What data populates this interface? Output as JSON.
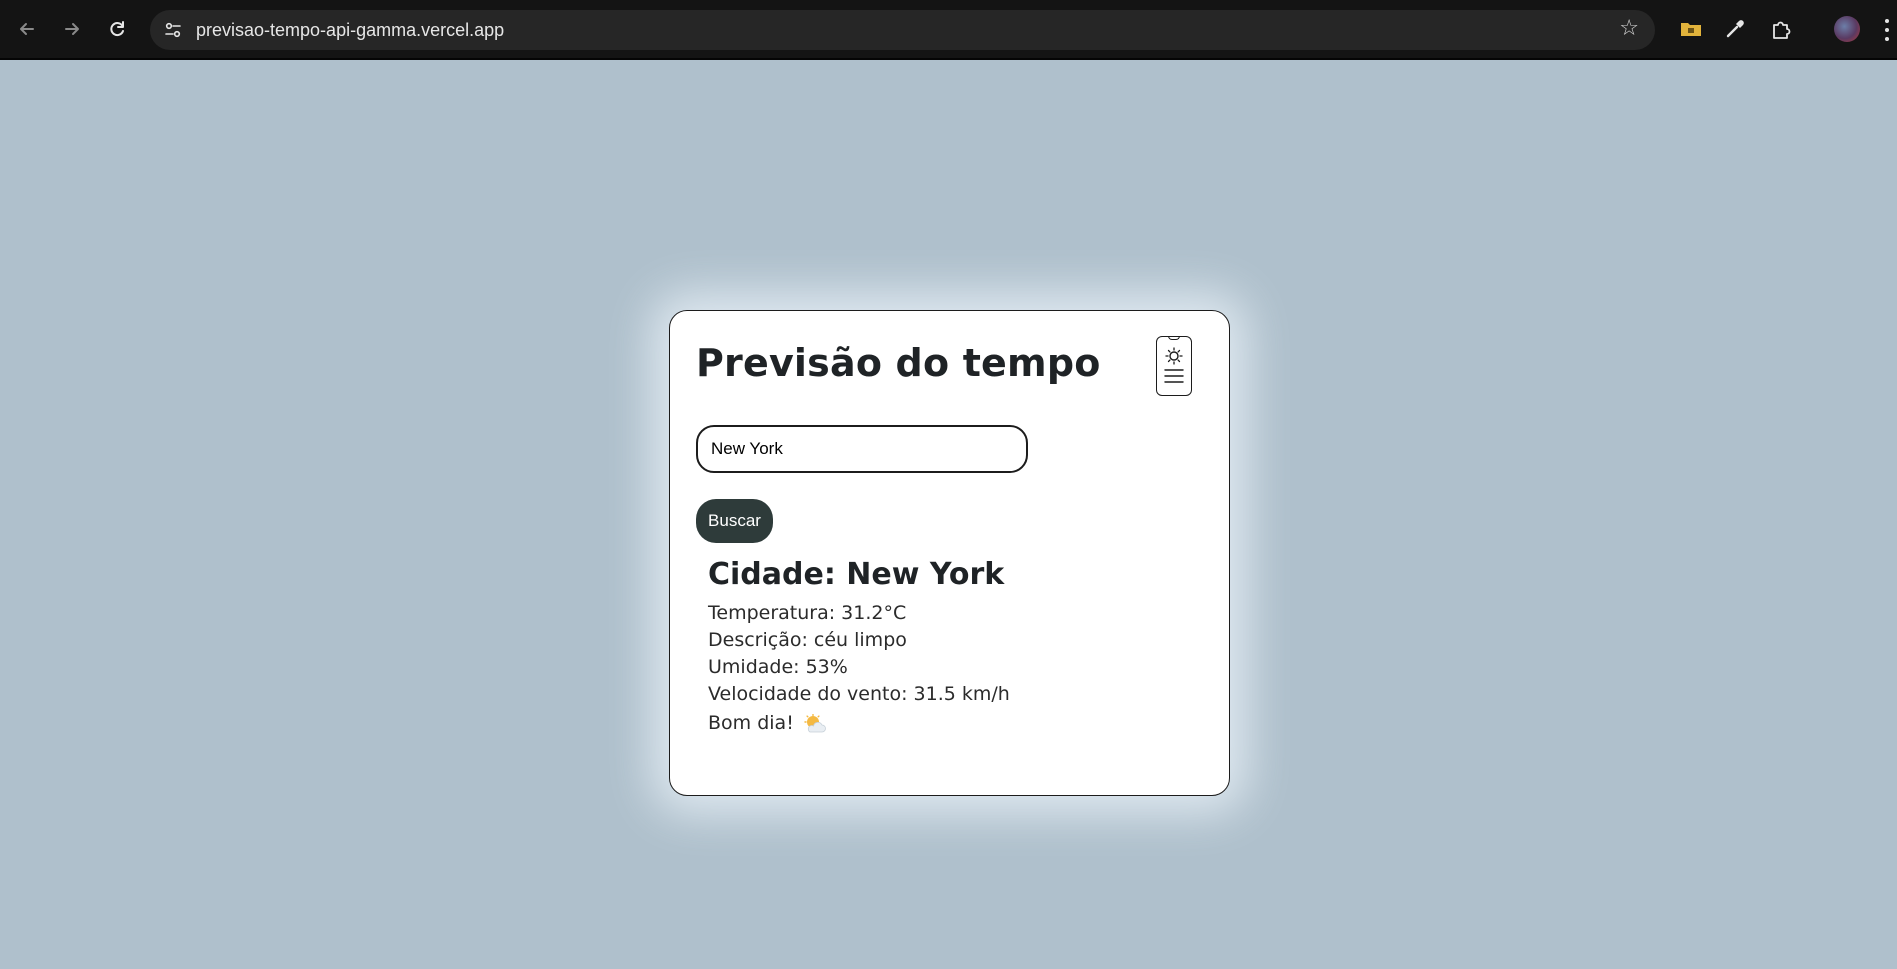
{
  "browser": {
    "url": "previsao-tempo-api-gamma.vercel.app",
    "back_icon": "arrow-left-icon",
    "forward_icon": "arrow-right-icon",
    "reload_icon": "reload-icon",
    "site_info_icon": "tune-icon",
    "bookmark_icon": "star-icon",
    "extensions": [
      "folder-icon",
      "eyedropper-icon",
      "puzzle-icon"
    ],
    "avatar_icon": "profile-avatar"
  },
  "app": {
    "title": "Previsão do tempo",
    "theme_toggle_icon": "sun-menu-icon",
    "search": {
      "value": "New York",
      "placeholder": ""
    },
    "search_button_label": "Buscar",
    "weather": {
      "city_line": "Cidade: New York",
      "temperature_line": "Temperatura: 31.2°C",
      "description_line": "Descrição: céu limpo",
      "humidity_line": "Umidade: 53%",
      "wind_line": "Velocidade do vento: 31.5 km/h",
      "greeting": "Bom dia!",
      "greeting_icon": "sun-behind-cloud-icon"
    }
  },
  "colors": {
    "page_background": "#afc0cc",
    "card_background": "#ffffff",
    "button_background": "#2e3b3a",
    "browser_chrome": "#141414"
  }
}
